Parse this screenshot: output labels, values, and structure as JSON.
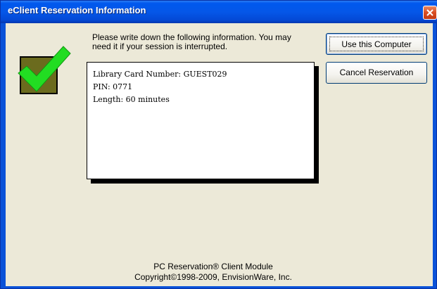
{
  "window": {
    "title": "eClient Reservation Information"
  },
  "message": {
    "line1": "Please write down the following information.  You may",
    "line2": "need it if your session is interrupted."
  },
  "info": {
    "card_line": "Library Card Number: GUEST029",
    "pin_line": "PIN: 0771",
    "length_line": "Length: 60 minutes"
  },
  "buttons": {
    "use_computer": "Use this Computer",
    "cancel_reservation": "Cancel Reservation"
  },
  "footer": {
    "product": "PC Reservation® Client Module",
    "copyright": "Copyright©1998-2009, EnvisionWare, Inc."
  },
  "colors": {
    "titlebar": "#0058ee",
    "client_bg": "#ece9d8",
    "check_green": "#22dd22",
    "check_box": "#6b6b1e"
  },
  "icons": {
    "check": "checkmark-icon",
    "close": "close-icon"
  }
}
